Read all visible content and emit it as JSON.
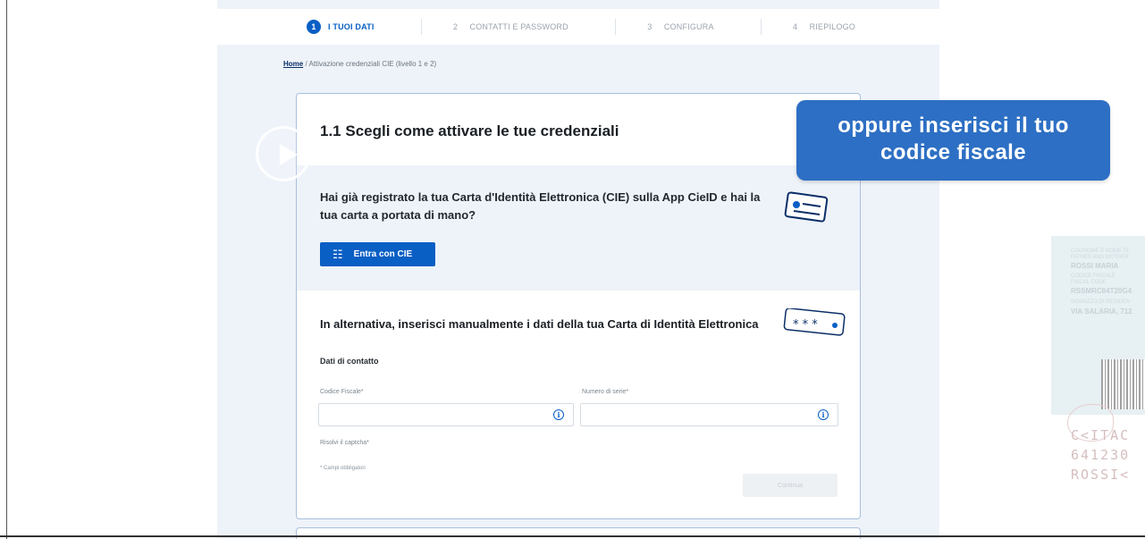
{
  "stepper": {
    "steps": [
      {
        "num": "1",
        "label": "I TUOI DATI"
      },
      {
        "num": "2",
        "label": "CONTATTI E PASSWORD"
      },
      {
        "num": "3",
        "label": "CONFIGURA"
      },
      {
        "num": "4",
        "label": "RIEPILOGO"
      }
    ]
  },
  "breadcrumb": {
    "home": "Home",
    "separator": "/",
    "current": "Attivazione credenziali CIE (livello 1 e 2)"
  },
  "card": {
    "title": "1.1 Scegli come attivare le tue credenziali",
    "cie_question": "Hai già registrato la tua Carta d'Identità Elettronica (CIE) sulla App CieID e hai la tua carta a portata di mano?",
    "cie_button": "Entra con CIE",
    "alt_title": "In alternativa, inserisci manualmente i dati della tua Carta di Identità Elettronica",
    "contact_section": "Dati di contatto",
    "fiscal_code_label": "Codice Fiscale*",
    "serial_label": "Numero di serie*",
    "captcha_label": "Risolvi il captcha*",
    "required_note": "* Campi obbligatori",
    "continue_button": "Continua"
  },
  "overlay_caption": {
    "line1": "oppure inserisci il tuo",
    "line2": "codice fiscale"
  },
  "id_card": {
    "label1": "COGNOME E NOME DI",
    "label1b": "FATHER AND MOTHER",
    "name": "ROSSI MARIA",
    "label2": "CODICE FISCALE",
    "label2b": "FISCAL CODE",
    "fiscal": "RSSMRC84T20G4",
    "label3": "INDIRIZZO DI RESIDEN",
    "address": "VIA SALARIA, 712",
    "mrz1": "C<ITAC",
    "mrz2": "641230",
    "mrz3": "ROSSI<"
  },
  "colors": {
    "primary": "#0a5fc4",
    "caption_bg": "#2d6fc4",
    "band_bg": "#eef3f9"
  }
}
